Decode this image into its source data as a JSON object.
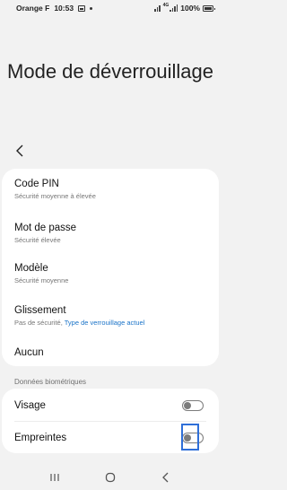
{
  "status_bar": {
    "carrier": "Orange F",
    "time": "10:53",
    "network": "4G",
    "battery": "100%"
  },
  "page": {
    "title": "Mode de déverrouillage"
  },
  "options": [
    {
      "title": "Code PIN",
      "subtitle": "Sécurité moyenne à élevée"
    },
    {
      "title": "Mot de passe",
      "subtitle": "Sécurité élevée"
    },
    {
      "title": "Modèle",
      "subtitle": "Sécurité moyenne"
    },
    {
      "title": "Glissement",
      "subtitle": "Pas de sécurité, ",
      "subtitle_link": "Type de verrouillage actuel"
    },
    {
      "title": "Aucun"
    }
  ],
  "biometrics": {
    "header": "Données biométriques",
    "items": [
      {
        "label": "Visage",
        "enabled": false
      },
      {
        "label": "Empreintes",
        "enabled": false
      }
    ]
  },
  "icons": {
    "back": "chevron-left-icon",
    "nav_recents": "recents-icon",
    "nav_home": "home-icon",
    "nav_back": "back-icon"
  },
  "colors": {
    "background": "#f2f2f2",
    "card": "#ffffff",
    "link": "#1a73c8",
    "highlight": "#2f6fd8"
  }
}
